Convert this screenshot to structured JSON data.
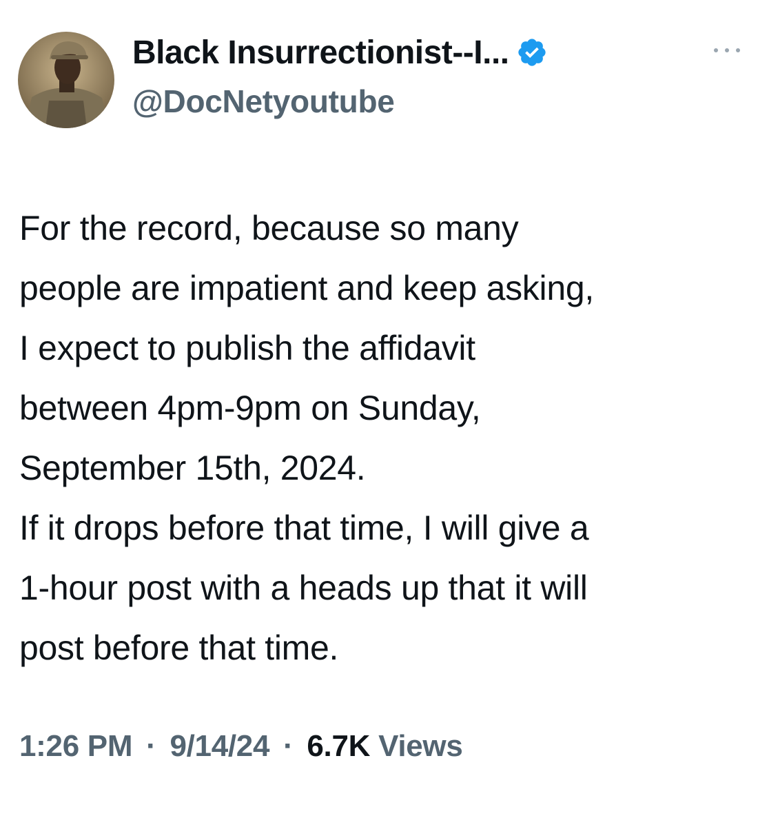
{
  "author": {
    "display_name": "Black Insurrectionist--I...",
    "handle": "@DocNetyoutube",
    "verified_color": "#1d9bf0",
    "avatar_icon": "avatar-soldier-portrait"
  },
  "post": {
    "lines": [
      "For the record, because so many",
      "people are impatient and keep asking,",
      "I expect to publish the affidavit",
      "between 4pm-9pm on Sunday,",
      "September 15th, 2024.",
      "If it drops before that time, I will give a",
      "1-hour post with a heads up that it will",
      "post before that time."
    ]
  },
  "meta": {
    "time": "1:26 PM",
    "separator": "·",
    "date": "9/14/24",
    "views_count": "6.7K",
    "views_label": "Views"
  },
  "icons": {
    "more": "more-dots-icon",
    "verified": "verified-badge-icon"
  }
}
